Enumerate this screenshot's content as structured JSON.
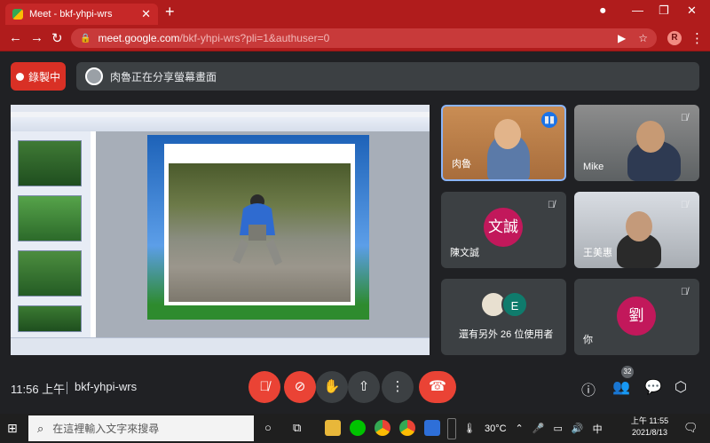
{
  "browser": {
    "tab_title": "Meet - bkf-yhpi-wrs",
    "tab_close": "✕",
    "new_tab": "+",
    "url_main": "meet.google.com",
    "url_path": "/bkf-yhpi-wrs?pli=1&authuser=0",
    "profile_initial": "R"
  },
  "meet": {
    "recording_label": "錄製中",
    "presenting_text": "肉魯正在分享螢幕畫面",
    "tiles": [
      {
        "name": "肉魯",
        "speaking": true
      },
      {
        "name": "Mike",
        "muted": true
      },
      {
        "name": "陳文誠",
        "avatar_text": "文誠",
        "muted": true
      },
      {
        "name": "王美惠",
        "muted": true
      },
      {
        "name": "還有另外 26 位使用者",
        "avatar_text": "E"
      },
      {
        "name": "你",
        "avatar_text": "劉",
        "muted": true
      }
    ],
    "clock": "11:56 上午",
    "meeting_code": "bkf-yhpi-wrs",
    "participant_count": "32",
    "accent_red": "#ea4335",
    "avatar_pink": "#c2185b"
  },
  "taskbar": {
    "search_placeholder": "在這裡輸入文字來搜尋",
    "temperature": "30°C",
    "ime": "中",
    "time": "上午 11:55",
    "date": "2021/8/13"
  }
}
